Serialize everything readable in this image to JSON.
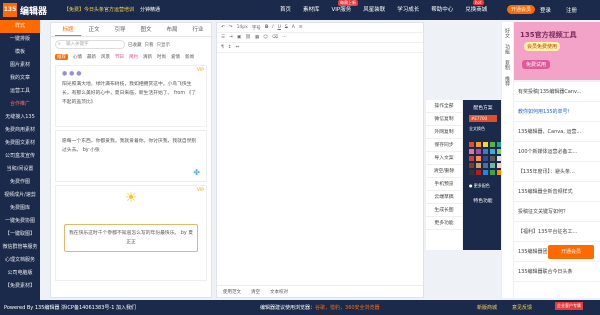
{
  "header": {
    "logo_mark": "135",
    "logo_text": "编辑器",
    "notice": "【免费】今日头条官方运营培训",
    "notice_link": "分钟精通",
    "nav": [
      "首页",
      "素材库",
      "VIP服务",
      "风星装联",
      "学习成长",
      "帮助中心",
      "兑换商城"
    ],
    "hot_badge": "每周上新",
    "hot_badge2": "hot",
    "vip_label": "开通会员",
    "login": "登录",
    "register": "注册"
  },
  "leftnav": {
    "items": [
      "样式",
      "一键排版",
      "模板",
      "图片素材",
      "我的文章",
      "运营工具",
      "合作推广",
      "无缝接入135",
      "免费商用素材",
      "免费图文素材",
      "公司盒发宣传",
      "当和/间设置",
      "免费作图",
      "视频成片/速剪",
      "免费图库",
      "一键免费协图",
      "【一键取图】",
      "微信群管等服务",
      "心理文档服务",
      "公司电脑版",
      "【免费素材】"
    ]
  },
  "materials": {
    "tabs": [
      "标题",
      "正文",
      "引导",
      "图文",
      "布局",
      "行业"
    ],
    "search_placeholder": "输入关键字",
    "check1": "已收藏",
    "check2": "只看",
    "check3": "只显示",
    "filters": [
      "推荐",
      "心情",
      "最新",
      "风景",
      "节日",
      "简约",
      "清新",
      "时尚",
      "爱情",
      "新闻"
    ],
    "card1_text": "阳光照满大地，绿叶满布树枝，我如相拥赏这中，小鸟飞快生长，有那么美好的心中，夏日来临，新生活开始了。 from 《了不起的盖茨比》",
    "card2_text": "愿每一个东西，你都爱我，我就爱着你。你讨厌我，我就自然别过头去。 by 小张",
    "card3_text": "我在快乐这时千个参都不知道怎么写的年份最快乐。 by 夏正正",
    "vip_tag": "VIP"
  },
  "editor": {
    "font_size": "14px",
    "font_name": "字号",
    "footer": [
      "使用范文",
      "清空",
      "文本校对"
    ]
  },
  "sidecol": {
    "items": [
      "操作全部",
      "微信复制",
      "外网复制",
      "保存同步",
      "导入文案",
      "清空/删除",
      "手机预览",
      "云端草稿",
      "生成长图",
      "更多功能"
    ]
  },
  "colorpanel": {
    "title": "配色方案",
    "hex": "#E7700",
    "all": "全文换色",
    "more": "● 更多配色",
    "special": "特色功能",
    "swatches": [
      "#e34d2e",
      "#f59b2e",
      "#f7d23a",
      "#53b44e",
      "#2a9d8f",
      "#e86fa4",
      "#a64ca6",
      "#3b7ccf",
      "#37b0d4",
      "#7dcf6b",
      "#c94040",
      "#ff8a4c",
      "#2d4d8a",
      "#5a5a5a",
      "#e0e0e0",
      "#8a3b1e",
      "#d0a063",
      "#4a6fa5",
      "#6bbd99",
      "#f5c6cb",
      "#333333",
      "#b71c1c",
      "#1e88e5",
      "#43a047",
      "#fb8c00"
    ]
  },
  "vbar": [
    "好文",
    "功能",
    "复制",
    "推荐",
    "常用",
    "反馈"
  ],
  "banner": {
    "line1": "135官方视频工具",
    "line2": "会员免费使用",
    "line3": "免费试用"
  },
  "news": [
    "有奖投稿|135编辑器Canv...",
    "教你如何用135的单号！",
    "135编辑器，Canva, 运营...",
    "100个新媒体运营必备工...",
    "【135年度讯】：避头条...",
    "135编辑器全新音频样式",
    "投稿征文关键写如何？",
    "【福利】135平台征名工...",
    "135编辑器团队协作功能...",
    "135编辑器联合今日头条"
  ],
  "float_vip": "开通会员",
  "footer": {
    "left": "Powered By 135编辑器 浙ICP备14061383号-1 加入我们",
    "mid_pre": "编辑器建议使用浏览器：",
    "mid_hl": "谷歌，猎豹，360安全浏览器",
    "r1": "新版商城",
    "r2": "意见反馈",
    "r3": "企业客户专属"
  }
}
